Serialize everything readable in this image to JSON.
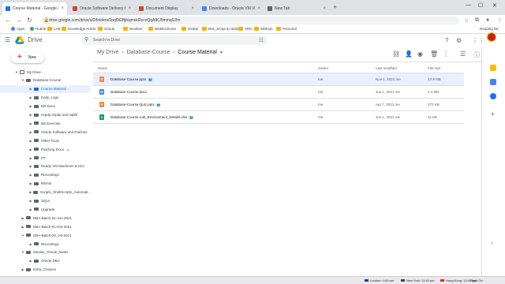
{
  "tabs": [
    {
      "label": "Course Material - Google Drive",
      "color": "#1a73e8",
      "active": true
    },
    {
      "label": "Oracle Software Delivery Cloud",
      "color": "#c74634"
    },
    {
      "label": "Document Display",
      "color": "#c74634"
    },
    {
      "label": "Downloads - Oracle VM VirtualB",
      "color": "#4285f4"
    },
    {
      "label": "New Tab",
      "color": "#5f6368"
    }
  ],
  "address": {
    "url": "drive.google.com/drive/u/2/folders/1pqOt2BjikqmdcRccoQqAfKJ5mmqG2m"
  },
  "bookmarks": [
    "Apps",
    "Rubrik",
    "LAB",
    "Knowledge Article",
    "Oracle",
    "Nexttive",
    "WebEx/Zoom",
    "Global",
    "Bnk_Script & rubrik...",
    "ARG",
    "MDEQL",
    "Personal"
  ],
  "bookmarks_more": "Reading list",
  "drive": {
    "app_name": "Drive",
    "search_placeholder": "Search in Drive",
    "new_label": "New"
  },
  "sidebar": {
    "items": [
      {
        "label": "My Drive",
        "level": 0,
        "icon": "drive"
      },
      {
        "label": "Database-Course",
        "level": 1,
        "expanded": true
      },
      {
        "label": "Course Material",
        "level": 2,
        "selected": true
      },
      {
        "label": "Daily_Logs",
        "level": 2
      },
      {
        "label": "DR Docs",
        "level": 2
      },
      {
        "label": "expdp impdp and sqlldr",
        "level": 2
      },
      {
        "label": "lab Exercise",
        "level": 2
      },
      {
        "label": "Oracle Software and Patches",
        "level": 2
      },
      {
        "label": "Other Tools",
        "level": 2
      },
      {
        "label": "Patching Docs",
        "level": 2,
        "shared": true
      },
      {
        "label": "PT",
        "level": 2
      },
      {
        "label": "Ready VM Machines & ISO",
        "level": 2
      },
      {
        "label": "Recordings",
        "level": 2
      },
      {
        "label": "RMAN",
        "level": 2
      },
      {
        "label": "Scripts_ShellScripts_Automati...",
        "level": 2
      },
      {
        "label": "SQLs",
        "level": 2
      },
      {
        "label": "Upgrade",
        "level": 2
      },
      {
        "label": "DBA-Batch-01-Jun-2021",
        "level": 1
      },
      {
        "label": "DBA-Batch-01-Oct-2021",
        "level": 1
      },
      {
        "label": "DBA-Batch-29_Jul-2021",
        "level": 1,
        "expanded": true
      },
      {
        "label": "Recordings",
        "level": 2
      },
      {
        "label": "ebooks_Oracle_Notes",
        "level": 1,
        "expanded": true
      },
      {
        "label": "Oracle DBA",
        "level": 2
      },
      {
        "label": "Extra_Classes",
        "level": 1
      }
    ]
  },
  "breadcrumb": [
    "My Drive",
    "Database-Course",
    "Course Material"
  ],
  "columns": {
    "name": "Name",
    "owner": "Owner",
    "modified": "Last modified",
    "size": "File size"
  },
  "files": [
    {
      "name": "Database-Course.pptx",
      "type": "P",
      "color": "#ee8a45",
      "shared": true,
      "owner": "me",
      "modified": "Nov 1, 2021 me",
      "size": "13.9 MB",
      "selected": true
    },
    {
      "name": "Database-Course.docx",
      "type": "W",
      "color": "#4285f4",
      "shared": false,
      "owner": "me",
      "modified": "Jun 1, 2021 me",
      "size": "1.4 MB"
    },
    {
      "name": "Database-Course-Quiz.pptx",
      "type": "P",
      "color": "#ee8a45",
      "shared": true,
      "owner": "me",
      "modified": "Apr 7, 2021 me",
      "size": "270 KB"
    },
    {
      "name": "Database-Course-Lab_Environment_Details.xlsx",
      "type": "X",
      "color": "#0f9d58",
      "shared": true,
      "owner": "me",
      "modified": "Jun 1, 2021 me",
      "size": "11 KB"
    }
  ],
  "taskbar": {
    "clocks": [
      {
        "text": "London: 4:40 am",
        "color": "#1a3c8c"
      },
      {
        "text": "New York: 11:40 pm",
        "color": "#3c3b6e"
      },
      {
        "text": "Hong Kong: 12:40 pm",
        "color": "#de2910"
      }
    ],
    "network": "Right On"
  }
}
